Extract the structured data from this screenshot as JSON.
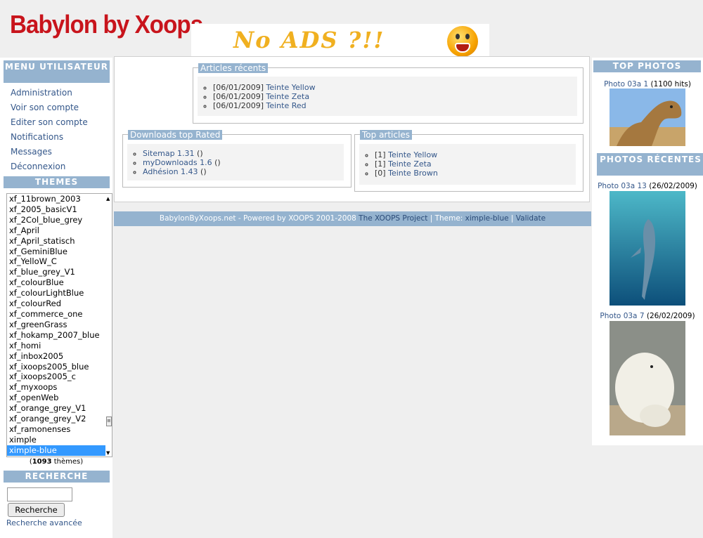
{
  "header": {
    "site_title": "Babylon by Xoops",
    "banner_text": "No ADS ?!!"
  },
  "left": {
    "user_menu_title": "MENU UTILISATEUR",
    "user_menu": [
      "Administration",
      "Voir son compte",
      "Editer son compte",
      "Notifications",
      "Messages",
      "Déconnexion"
    ],
    "themes_title": "THEMES",
    "themes": [
      "xf_11brown_2003",
      "xf_2005_basicV1",
      "xf_2Col_blue_grey",
      "xf_April",
      "xf_April_statisch",
      "xf_GeminiBlue",
      "xf_YelloW_C",
      "xf_blue_grey_V1",
      "xf_colourBlue",
      "xf_colourLightBlue",
      "xf_colourRed",
      "xf_commerce_one",
      "xf_greenGrass",
      "xf_hokamp_2007_blue",
      "xf_homi",
      "xf_inbox2005",
      "xf_ixoops2005_blue",
      "xf_ixoops2005_c",
      "xf_myxoops",
      "xf_openWeb",
      "xf_orange_grey_V1",
      "xf_orange_grey_V2",
      "xf_ramonenses",
      "ximple",
      "ximple-blue"
    ],
    "selected_theme": "ximple-blue",
    "theme_count_number": "1093",
    "theme_count_suffix": " thèmes)",
    "theme_count_prefix": "(",
    "search_title": "RECHERCHE",
    "search_button": "Recherche",
    "advanced_search": "Recherche avancée"
  },
  "center": {
    "recent_articles_title": "Articles récents",
    "recent_articles": [
      {
        "date": "[06/01/2009]",
        "title": "Teinte Yellow"
      },
      {
        "date": "[06/01/2009]",
        "title": "Teinte Zeta"
      },
      {
        "date": "[06/01/2009]",
        "title": "Teinte Red"
      }
    ],
    "downloads_title": "Downloads top Rated",
    "downloads": [
      {
        "name": "Sitemap 1.31",
        "suffix": " ()"
      },
      {
        "name": "myDownloads 1.6",
        "suffix": " ()"
      },
      {
        "name": "Adhésion 1.43",
        "suffix": " ()"
      }
    ],
    "top_articles_title": "Top articles",
    "top_articles": [
      {
        "count": "[1]",
        "title": "Teinte Yellow"
      },
      {
        "count": "[1]",
        "title": "Teinte Zeta"
      },
      {
        "count": "[0]",
        "title": "Teinte Brown"
      }
    ]
  },
  "footer": {
    "text": "BabylonByXoops.net - Powered by XOOPS 2001-2008",
    "project_link": "The XOOPS Project",
    "theme_label": " | Theme: ",
    "theme_link": "ximple-blue",
    "sep": " | ",
    "validate_link": "Validate"
  },
  "right": {
    "top_photos_title": "TOP PHOTOS",
    "top_photo": {
      "name": "Photo 03a 1",
      "info": " (1100 hits)"
    },
    "recent_photos_title": "PHOTOS RÉCENTES",
    "recent_photos": [
      {
        "name": "Photo 03a 13",
        "info": " (26/02/2009)"
      },
      {
        "name": "Photo 03a 7",
        "info": " (26/02/2009)"
      }
    ]
  }
}
